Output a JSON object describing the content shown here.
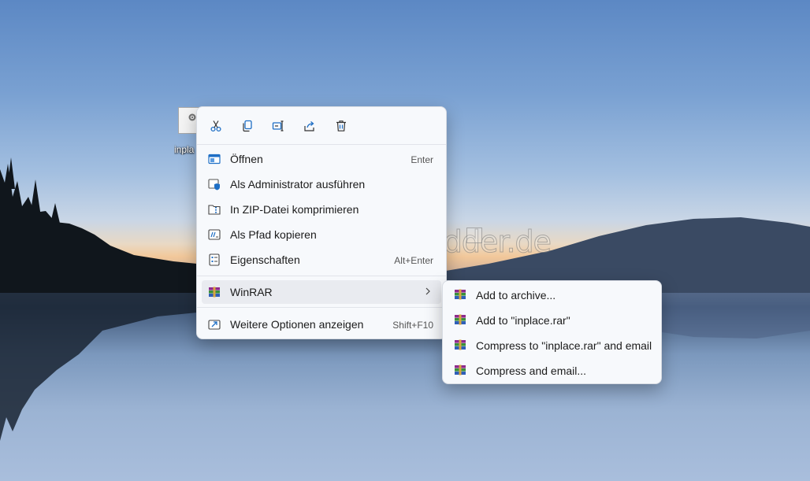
{
  "desktop": {
    "icon_label": "inpla",
    "watermark": "Deskmodder.de"
  },
  "toolbar": {
    "buttons": [
      {
        "name": "cut",
        "icon": "scissors-icon"
      },
      {
        "name": "copy",
        "icon": "copy-icon"
      },
      {
        "name": "rename",
        "icon": "rename-icon"
      },
      {
        "name": "share",
        "icon": "share-icon"
      },
      {
        "name": "delete",
        "icon": "trash-icon"
      }
    ]
  },
  "menu": {
    "items": [
      {
        "label": "Öffnen",
        "shortcut": "Enter",
        "icon": "open-icon"
      },
      {
        "label": "Als Administrator ausführen",
        "shortcut": "",
        "icon": "admin-shield-icon"
      },
      {
        "label": "In ZIP-Datei komprimieren",
        "shortcut": "",
        "icon": "zip-folder-icon"
      },
      {
        "label": "Als Pfad kopieren",
        "shortcut": "",
        "icon": "copy-path-icon"
      },
      {
        "label": "Eigenschaften",
        "shortcut": "Alt+Enter",
        "icon": "properties-icon"
      },
      {
        "label": "WinRAR",
        "shortcut": "",
        "icon": "winrar-icon"
      },
      {
        "label": "Weitere Optionen anzeigen",
        "shortcut": "Shift+F10",
        "icon": "more-options-icon"
      }
    ]
  },
  "submenu": {
    "items": [
      {
        "label": "Add to archive...",
        "icon": "winrar-icon"
      },
      {
        "label": "Add to \"inplace.rar\"",
        "icon": "winrar-icon"
      },
      {
        "label": "Compress to \"inplace.rar\" and email",
        "icon": "winrar-icon"
      },
      {
        "label": "Compress and email...",
        "icon": "winrar-icon"
      }
    ]
  },
  "colors": {
    "accent": "#1f6fc5",
    "menu_bg": "#f7f9fc",
    "hover_bg": "#e9ebf0"
  }
}
